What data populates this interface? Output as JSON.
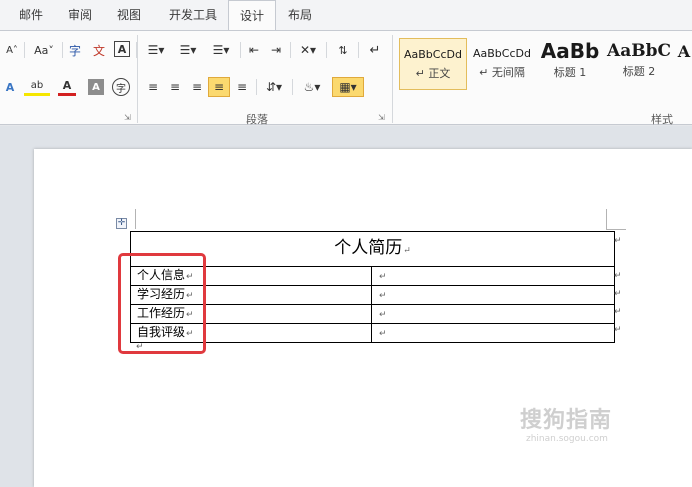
{
  "tabs": [
    "邮件",
    "审阅",
    "视图",
    "开发工具",
    "设计",
    "布局"
  ],
  "active_tab": "设计",
  "ribbon": {
    "font_group": {
      "grow_font": "A˄",
      "change_case": "Aa˅",
      "phonetic": "字",
      "pinyin_guide": "文",
      "char_border": "A",
      "text_effect": "A",
      "highlight": "ab",
      "font_color": "A",
      "char_shading": "A",
      "enclose_char": "字"
    },
    "paragraph_group_label": "段落",
    "styles_group_label": "样式",
    "styles": [
      {
        "sample": "AaBbCcDd",
        "name": "↵ 正文",
        "selected": true
      },
      {
        "sample": "AaBbCcDd",
        "name": "↵ 无间隔",
        "selected": false
      },
      {
        "sample": "AaBb",
        "name": "标题 1",
        "selected": false
      },
      {
        "sample": "AaBbC",
        "name": "标题 2",
        "selected": false
      },
      {
        "sample": "A",
        "name": "",
        "selected": false
      }
    ]
  },
  "document": {
    "table": {
      "title": "个人简历",
      "rows": [
        "个人信息",
        "学习经历",
        "工作经历",
        "自我评级"
      ]
    },
    "paragraph_mark": "↵"
  },
  "watermark": {
    "text": "搜狗指南",
    "sub": "zhinan.sogou.com"
  },
  "colors": {
    "highlight_box": "#e0393e",
    "selected_style_border": "#e3bd5c",
    "ribbon_bg": "#fbfbfb"
  }
}
